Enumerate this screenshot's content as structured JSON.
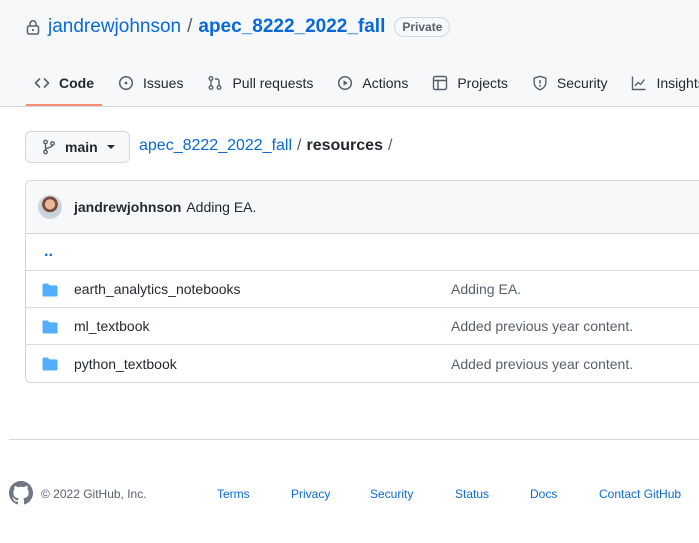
{
  "repo": {
    "owner": "jandrewjohnson",
    "name": "apec_8222_2022_fall",
    "visibility": "Private"
  },
  "tabs": [
    {
      "label": "Code",
      "icon": "code-icon",
      "selected": true
    },
    {
      "label": "Issues",
      "icon": "issue-opened-icon"
    },
    {
      "label": "Pull requests",
      "icon": "git-pull-request-icon"
    },
    {
      "label": "Actions",
      "icon": "play-icon"
    },
    {
      "label": "Projects",
      "icon": "table-icon"
    },
    {
      "label": "Security",
      "icon": "shield-icon"
    },
    {
      "label": "Insights",
      "icon": "graph-icon"
    }
  ],
  "branch": {
    "name": "main"
  },
  "breadcrumb": {
    "root": "apec_8222_2022_fall",
    "current": "resources",
    "separator": "/"
  },
  "commit": {
    "author": "jandrewjohnson",
    "message": "Adding EA."
  },
  "parent_dir": "..",
  "files": [
    {
      "name": "earth_analytics_notebooks",
      "message": "Adding EA.",
      "type": "folder"
    },
    {
      "name": "ml_textbook",
      "message": "Added previous year content.",
      "type": "folder"
    },
    {
      "name": "python_textbook",
      "message": "Added previous year content.",
      "type": "folder"
    }
  ],
  "footer": {
    "copyright": "© 2022 GitHub, Inc.",
    "links": [
      "Terms",
      "Privacy",
      "Security",
      "Status",
      "Docs",
      "Contact GitHub"
    ]
  },
  "colors": {
    "link": "#0969da",
    "tab_underline": "#fd8c73",
    "folder": "#54aeff",
    "border": "#d0d7de"
  }
}
